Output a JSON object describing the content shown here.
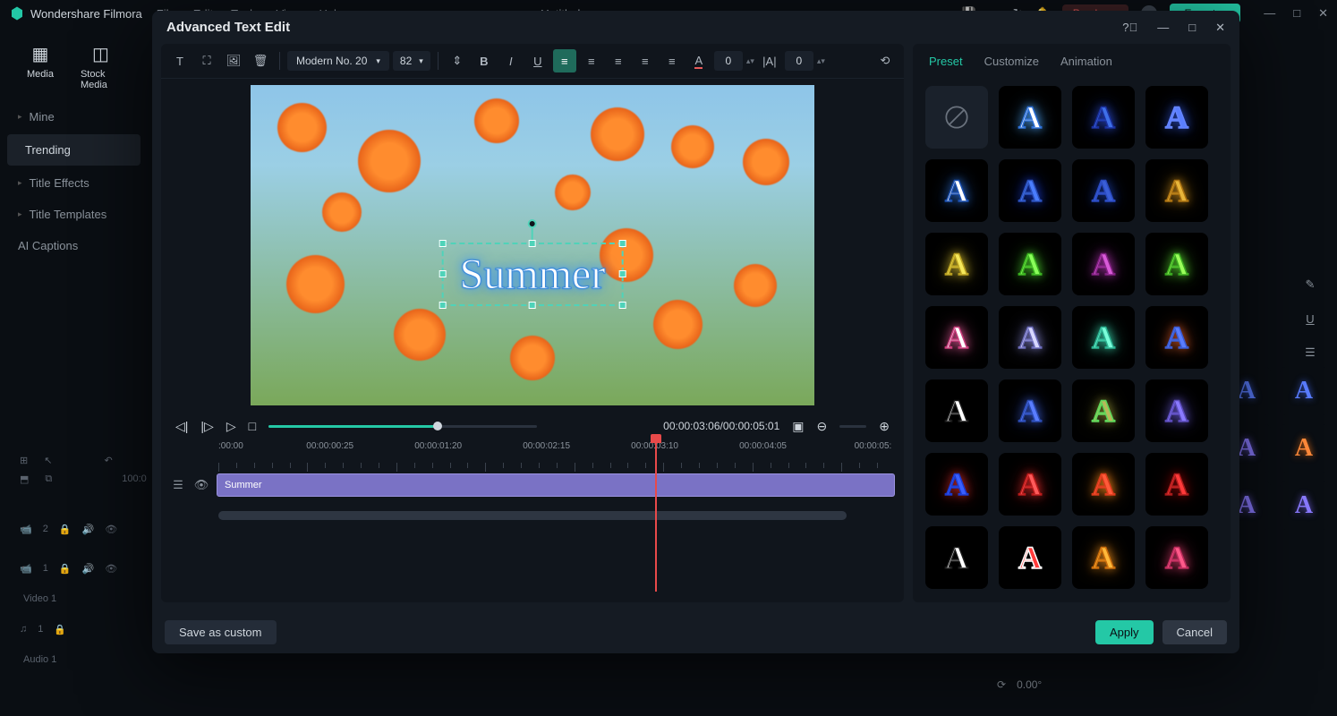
{
  "app": {
    "name": "Wondershare Filmora",
    "doc": "Untitled"
  },
  "topmenu": [
    "File",
    "Edit",
    "Tools",
    "View",
    "Help"
  ],
  "topbuttons": {
    "purchase": "Purchase",
    "export": "Export"
  },
  "sidebar": {
    "hdr": [
      {
        "icon": "media",
        "label": "Media"
      },
      {
        "icon": "stock",
        "label": "Stock Media"
      }
    ],
    "items": [
      "Mine",
      "Trending",
      "Title Effects",
      "Title Templates",
      "AI Captions"
    ],
    "active": 1
  },
  "modal": {
    "title": "Advanced Text Edit",
    "font": "Modern No. 20",
    "size": "82",
    "spacing": "0",
    "tracking": "0",
    "text": "Summer",
    "time_current": "00:00:03:06",
    "time_total": "00:00:05:01",
    "ruler": [
      ":00:00",
      "00:00:00:25",
      "00:00:01:20",
      "00:00:02:15",
      "00:00:03:10",
      "00:00:04:05",
      "00:00:05:"
    ],
    "clip_label": "Summer",
    "save_custom": "Save as custom",
    "apply": "Apply",
    "cancel": "Cancel",
    "tabs": [
      "Preset",
      "Customize",
      "Animation"
    ],
    "active_tab": 0,
    "presets": [
      {
        "type": "none"
      },
      {
        "fill": "#fff",
        "shadow": "#4fa8ff",
        "stroke": "#2c6fd6"
      },
      {
        "fill": "#3e6fe8",
        "shadow": "#2a4acf",
        "stroke": "#1a2f9c"
      },
      {
        "fill": "#5a7fff",
        "shadow": "#2e50cc",
        "stroke": "#6585ff"
      },
      {
        "fill": "#fff",
        "shadow": "#2c6fd6",
        "stroke": "#1a4fb0"
      },
      {
        "fill": "#4a7dff",
        "shadow": "#183acf",
        "stroke": "#2a4fb8"
      },
      {
        "fill": "#3a5fd8",
        "shadow": "#1a3a9f",
        "stroke": "#2a4ac0"
      },
      {
        "fill": "#e8b53a",
        "shadow": "#c78a1a",
        "stroke": "#a86f10"
      },
      {
        "fill": "#f5e85a",
        "shadow": "#d8c030",
        "stroke": "#b89f20"
      },
      {
        "fill": "#8aff5a",
        "shadow": "#4fd830",
        "stroke": "#3ab020"
      },
      {
        "fill": "#d85ad8",
        "shadow": "#a830a8",
        "stroke": "#802080"
      },
      {
        "fill": "#9aff5a",
        "shadow": "#5ad830",
        "stroke": "#3aa820"
      },
      {
        "fill": "#fff",
        "shadow": "#e85a9a",
        "stroke": "#c83a7a"
      },
      {
        "fill": "#d8d8ff",
        "shadow": "#8a8ad8",
        "stroke": "#6a6ab8"
      },
      {
        "fill": "#7affda",
        "shadow": "#3ad8b0",
        "stroke": "#2ab090"
      },
      {
        "fill": "#5a7dff",
        "shadow": "#d85a2a",
        "stroke": "#3a5acf"
      },
      {
        "fill": "#fff",
        "shadow": "none",
        "stroke": "#1a1a1a"
      },
      {
        "fill": "#5a7dff",
        "shadow": "#3a5acf",
        "stroke": "#2a4ab0"
      },
      {
        "fill": "#b8b85a",
        "shadow": "#8a8a30",
        "stroke": "#5ad85a"
      },
      {
        "fill": "#8a7aff",
        "shadow": "#6a5ad8",
        "stroke": "#5a4ab8"
      },
      {
        "fill": "#3a5fff",
        "shadow": "#d82a2a",
        "stroke": "#1a3acf"
      },
      {
        "fill": "#ff5a5a",
        "shadow": "#e82a2a",
        "stroke": "#b81a1a"
      },
      {
        "fill": "#ff5a3a",
        "shadow": "#ff8a1a",
        "stroke": "#d83a1a"
      },
      {
        "fill": "#ff3a3a",
        "shadow": "#880808",
        "stroke": "#a81a1a"
      },
      {
        "fill": "#fff",
        "shadow": "none",
        "stroke": "#1a1a1a"
      },
      {
        "fill": "#ff3a3a",
        "shadow": "none",
        "stroke": "#fff"
      },
      {
        "fill": "#ffb83a",
        "shadow": "#e88a1a",
        "stroke": "#c86a0a"
      },
      {
        "fill": "#ff5a8a",
        "shadow": "#d83a6a",
        "stroke": "#b82a5a"
      }
    ]
  },
  "bg_presets_right": [
    {
      "fill": "#5a7dff",
      "shadow": "#3a5acf"
    },
    {
      "fill": "#5a7dff",
      "shadow": "#3a5acf"
    },
    {
      "fill": "#8a7aff",
      "shadow": "#6a5ad8"
    },
    {
      "fill": "#ff8a3a",
      "shadow": "#d86a1a"
    },
    {
      "fill": "#8a7aff",
      "shadow": "#6a5ad8"
    },
    {
      "fill": "#8a7aff",
      "shadow": "#6a5ad8"
    }
  ],
  "bg_timeline": {
    "tracks": [
      {
        "icon": "📹",
        "idx": "2",
        "label": ""
      },
      {
        "icon": "📹",
        "idx": "1",
        "label": "Video 1"
      },
      {
        "icon": "♫",
        "idx": "1",
        "label": "Audio 1"
      }
    ],
    "timecode": "100:0"
  },
  "props": {
    "value": "0.00°"
  }
}
